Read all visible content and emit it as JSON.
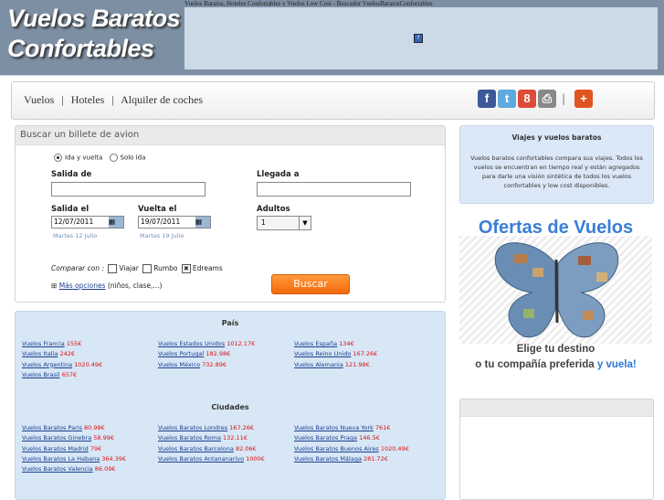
{
  "header": {
    "logo_line1": "Vuelos Baratos",
    "logo_line2": "Confortables",
    "ad_title": "Vuelos Baratos, Hoteles Confortables y Vuelos Low Cost - Buscador VuelosBaratosConfortables",
    "ad_icon": "?"
  },
  "nav": {
    "items": [
      "Vuelos",
      "Hoteles",
      "Alquiler de coches"
    ],
    "separator": "|"
  },
  "social": {
    "facebook": "f",
    "twitter": "t",
    "google": "8",
    "print": "⎙",
    "plus": "+"
  },
  "search": {
    "title": "Buscar un billete de avion",
    "radio_round": "Ida y vuelta",
    "radio_oneway": "Solo ida",
    "from_label": "Salida de",
    "to_label": "Llegada a",
    "depart_label": "Salida el",
    "return_label": "Vuelta el",
    "adults_label": "Adultos",
    "depart_value": "12/07/2011",
    "return_value": "19/07/2011",
    "adults_value": "1",
    "depart_hint": "Martes 12 Julio",
    "return_hint": "Martes 19 Julio",
    "compare_label": "Comparar con :",
    "compare": [
      "Viajar",
      "Rumbo",
      "Edreams"
    ],
    "more_options": "Más opciones",
    "more_options_suffix": "(niños, clase,...)",
    "more_options_sign": "⊞",
    "button": "Buscar"
  },
  "links": {
    "paises_title": "País",
    "paises": [
      {
        "name": "Vuelos Francia",
        "price": "155€"
      },
      {
        "name": "Vuelos Estados Unidos",
        "price": "1012.17€"
      },
      {
        "name": "Vuelos España",
        "price": "134€"
      },
      {
        "name": "Vuelos Italia",
        "price": "242€"
      },
      {
        "name": "Vuelos Portugal",
        "price": "182.98€"
      },
      {
        "name": "Vuelos Reino Unido",
        "price": "167.26€"
      },
      {
        "name": "Vuelos Argentina",
        "price": "1020.49€"
      },
      {
        "name": "Vuelos México",
        "price": "732.89€"
      },
      {
        "name": "Vuelos Alemania",
        "price": "121.98€"
      },
      {
        "name": "Vuelos Brasil",
        "price": "657€"
      }
    ],
    "ciudades_title": "Ciudades",
    "ciudades": [
      {
        "name": "Vuelos Baratos Paris",
        "price": "80.98€"
      },
      {
        "name": "Vuelos Baratos Londres",
        "price": "167.26€"
      },
      {
        "name": "Vuelos Baratos Nueva York",
        "price": "761€"
      },
      {
        "name": "Vuelos Baratos Ginebra",
        "price": "58.99€"
      },
      {
        "name": "Vuelos Baratos Roma",
        "price": "132.11€"
      },
      {
        "name": "Vuelos Baratos Praga",
        "price": "146.5€"
      },
      {
        "name": "Vuelos Baratos Madrid",
        "price": "79€"
      },
      {
        "name": "Vuelos Baratos Barcelona",
        "price": "82.06€"
      },
      {
        "name": "Vuelos Baratos Buenos Aires",
        "price": "1020.49€"
      },
      {
        "name": "Vuelos Baratos La Habana",
        "price": "364.39€"
      },
      {
        "name": "Vuelos Baratos Antananarivo",
        "price": "1000€"
      },
      {
        "name": "Vuelos Baratos Málaga",
        "price": "281.72€"
      },
      {
        "name": "Vuelos Baratos Valencia",
        "price": "86.09€"
      }
    ]
  },
  "sidebar": {
    "box_title": "Viajes y vuelos baratos",
    "box_text": "Vuelos baratos confortables compara sus viajes. Todos los vuelos se encuentran en tiempo real y están agregados para darle una visión sintética de todos los vuelos confortables y low cost disponibles.",
    "promo_title": "Ofertas de Vuelos",
    "promo_line1": "Elige tu destino",
    "promo_line2": "o tu compañía preferida",
    "promo_line2_accent": "y vuela!"
  }
}
